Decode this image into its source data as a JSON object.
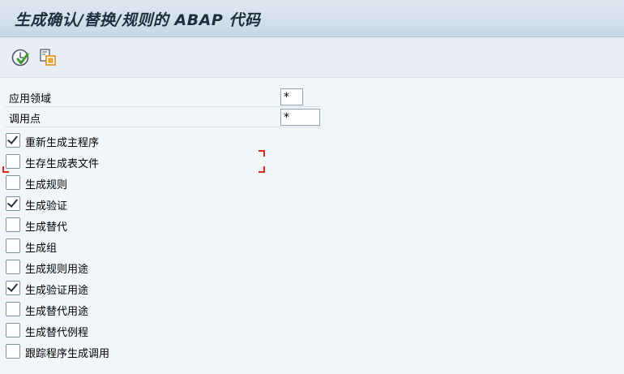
{
  "window": {
    "title": "生成确认/替换/规则的 ABAP 代码"
  },
  "toolbar": {
    "buttons": [
      {
        "name": "execute",
        "icon": "execute-clock-icon"
      },
      {
        "name": "copy",
        "icon": "copy-structure-icon"
      }
    ]
  },
  "fields": {
    "application_area": {
      "label": "应用领域",
      "value": "*"
    },
    "call_point": {
      "label": "调用点",
      "value": "*"
    }
  },
  "checkboxes": [
    {
      "label": "重新生成主程序",
      "checked": true
    },
    {
      "label": "生存生成表文件",
      "checked": false,
      "focused": true
    },
    {
      "label": "生成规则",
      "checked": false
    },
    {
      "label": "生成验证",
      "checked": true
    },
    {
      "label": "生成替代",
      "checked": false
    },
    {
      "label": "生成组",
      "checked": false
    },
    {
      "label": "生成规则用途",
      "checked": false
    },
    {
      "label": "生成验证用途",
      "checked": true
    },
    {
      "label": "生成替代用途",
      "checked": false
    },
    {
      "label": "生成替代例程",
      "checked": false
    },
    {
      "label": "跟踪程序生成调用",
      "checked": false
    }
  ],
  "colors": {
    "focus_marker": "#d9281e",
    "title_bar": "#d3dfeb",
    "background": "#f3f6f9"
  }
}
